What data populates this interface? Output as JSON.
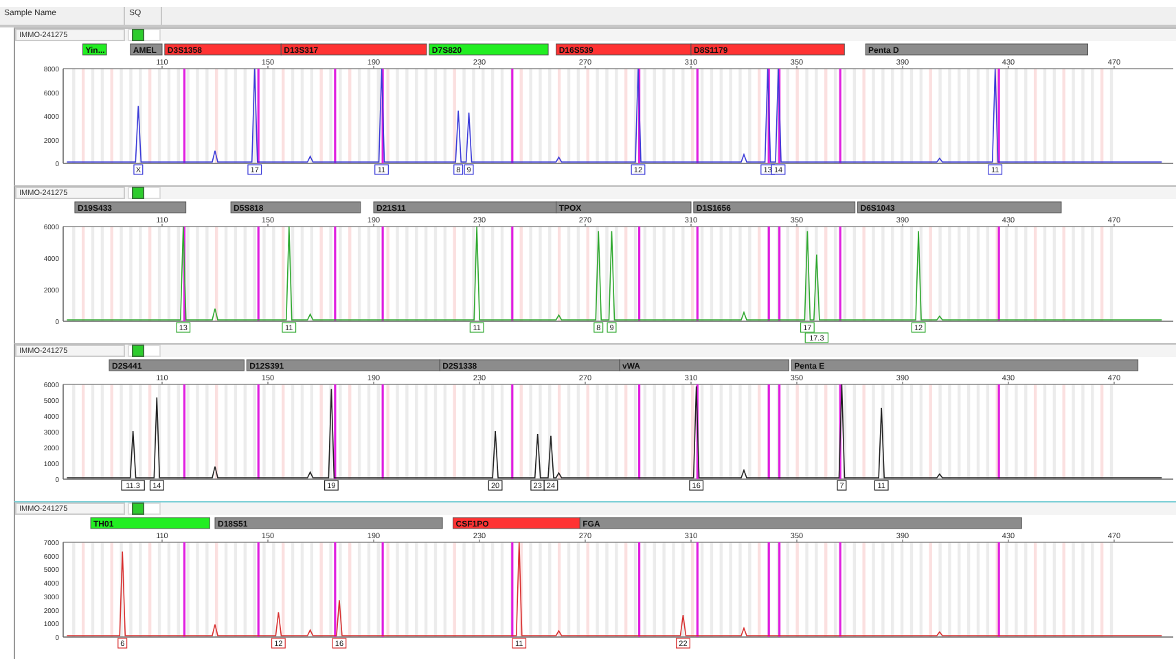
{
  "header": {
    "columns": [
      "Sample Name",
      "SQ"
    ]
  },
  "panels": [
    {
      "sample": "IMMO-241275",
      "status": {
        "color": "#2ecc2e"
      },
      "color": "#3a3ad8",
      "markers": [
        {
          "name": "Yin...",
          "color": "#22ee22"
        },
        {
          "name": "AMEL",
          "color": "#8c8c8c"
        },
        {
          "name": "D3S1358",
          "color": "#ff3333"
        },
        {
          "name": "D13S317",
          "color": "#ff3333"
        },
        {
          "name": "D7S820",
          "color": "#22ee22"
        },
        {
          "name": "D16S539",
          "color": "#ff3333"
        },
        {
          "name": "D8S1179",
          "color": "#ff3333"
        },
        {
          "name": "Penta D",
          "color": "#8c8c8c"
        }
      ],
      "x_ticks": [
        "110",
        "150",
        "190",
        "230",
        "270",
        "310",
        "350",
        "390",
        "430",
        "470"
      ],
      "y_ticks": [
        "8000",
        "6000",
        "4000",
        "2000",
        "0"
      ],
      "alleles": [
        "X",
        "17",
        "11",
        "8",
        "9",
        "12",
        "13",
        "14",
        "11"
      ]
    },
    {
      "sample": "IMMO-241275",
      "status": {
        "color": "#2ecc2e"
      },
      "color": "#2fa82f",
      "markers": [
        {
          "name": "D19S433",
          "color": "#8c8c8c"
        },
        {
          "name": "D5S818",
          "color": "#8c8c8c"
        },
        {
          "name": "D21S11",
          "color": "#8c8c8c"
        },
        {
          "name": "TPOX",
          "color": "#8c8c8c"
        },
        {
          "name": "D1S1656",
          "color": "#8c8c8c"
        },
        {
          "name": "D6S1043",
          "color": "#8c8c8c"
        }
      ],
      "x_ticks": [
        "110",
        "150",
        "190",
        "230",
        "270",
        "310",
        "350",
        "390",
        "430",
        "470"
      ],
      "y_ticks": [
        "6000",
        "4000",
        "2000",
        "0"
      ],
      "alleles": [
        "13",
        "11",
        "11",
        "8",
        "9",
        "17",
        "17.3",
        "12"
      ]
    },
    {
      "sample": "IMMO-241275",
      "status": {
        "color": "#2ecc2e"
      },
      "color": "#222222",
      "markers": [
        {
          "name": "D2S441",
          "color": "#8c8c8c"
        },
        {
          "name": "D12S391",
          "color": "#8c8c8c"
        },
        {
          "name": "D2S1338",
          "color": "#8c8c8c"
        },
        {
          "name": "vWA",
          "color": "#8c8c8c"
        },
        {
          "name": "Penta E",
          "color": "#8c8c8c"
        }
      ],
      "x_ticks": [
        "110",
        "150",
        "190",
        "230",
        "270",
        "310",
        "350",
        "390",
        "430",
        "470"
      ],
      "y_ticks": [
        "6000",
        "5000",
        "4000",
        "3000",
        "2000",
        "1000",
        "0"
      ],
      "alleles": [
        "11.3",
        "14",
        "19",
        "20",
        "23",
        "24",
        "16",
        "7",
        "11"
      ]
    },
    {
      "sample": "IMMO-241275",
      "status": {
        "color": "#2ecc2e"
      },
      "color": "#d83030",
      "markers": [
        {
          "name": "TH01",
          "color": "#22ee22"
        },
        {
          "name": "D18S51",
          "color": "#8c8c8c"
        },
        {
          "name": "CSF1PO",
          "color": "#ff3333"
        },
        {
          "name": "FGA",
          "color": "#8c8c8c"
        }
      ],
      "x_ticks": [
        "110",
        "150",
        "190",
        "230",
        "270",
        "310",
        "350",
        "390",
        "430",
        "470"
      ],
      "y_ticks": [
        "7000",
        "6000",
        "5000",
        "4000",
        "3000",
        "2000",
        "1000",
        "0"
      ],
      "alleles": [
        "6",
        "12",
        "16",
        "11",
        "22"
      ]
    }
  ]
}
